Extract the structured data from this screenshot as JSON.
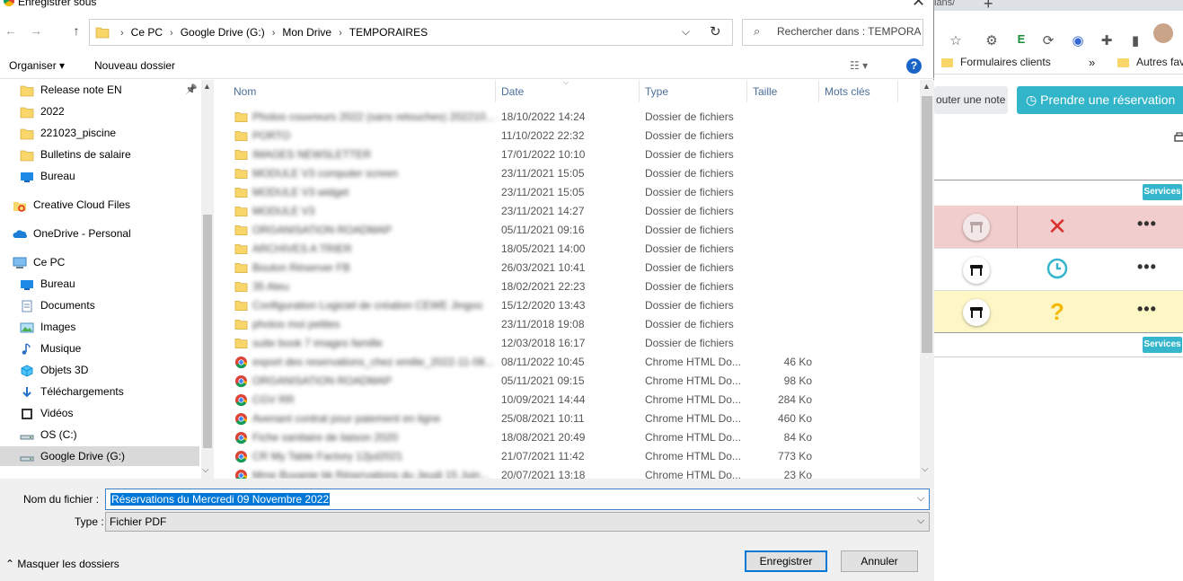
{
  "dialog": {
    "title": "Enregistrer sous",
    "close_glyph": "✕",
    "nav": {
      "back": "←",
      "forward": "→",
      "up": "↑",
      "dropdown": "⌵",
      "refresh": "↻"
    },
    "breadcrumbs": [
      "Ce PC",
      "Google Drive (G:)",
      "Mon Drive",
      "TEMPORAIRES"
    ],
    "search_placeholder": "Rechercher dans : TEMPORA...",
    "toolbar": {
      "organize": "Organiser ▾",
      "new_folder": "Nouveau dossier",
      "view": "☷ ▾",
      "help": "?"
    },
    "nav_pane": [
      {
        "label": "Release note EN",
        "icon": "folder-icon",
        "pinned": true
      },
      {
        "label": "2022",
        "icon": "folder-icon"
      },
      {
        "label": "221023_piscine",
        "icon": "folder-icon"
      },
      {
        "label": "Bulletins de salaire",
        "icon": "folder-icon"
      },
      {
        "label": "Bureau",
        "icon": "desktop-icon"
      },
      {
        "label": "Creative Cloud Files",
        "icon": "creative-cloud-icon"
      },
      {
        "label": "OneDrive - Personal",
        "icon": "onedrive-icon"
      },
      {
        "label": "Ce PC",
        "icon": "computer-icon"
      },
      {
        "label": "Bureau",
        "icon": "desktop-icon"
      },
      {
        "label": "Documents",
        "icon": "documents-icon"
      },
      {
        "label": "Images",
        "icon": "images-icon"
      },
      {
        "label": "Musique",
        "icon": "music-icon"
      },
      {
        "label": "Objets 3D",
        "icon": "objects3d-icon"
      },
      {
        "label": "Téléchargements",
        "icon": "downloads-icon"
      },
      {
        "label": "Vidéos",
        "icon": "videos-icon"
      },
      {
        "label": "OS (C:)",
        "icon": "drive-icon"
      },
      {
        "label": "Google Drive (G:)",
        "icon": "drive-icon",
        "selected": true
      }
    ],
    "columns": [
      "Nom",
      "Date",
      "Type",
      "Taille",
      "Mots clés"
    ],
    "files": [
      {
        "name": "Photos couvreurs 2022 (sans retouches) 202210...",
        "date": "18/10/2022 14:24",
        "type": "Dossier de fichiers",
        "size": "",
        "kind": "folder"
      },
      {
        "name": "PORTO",
        "date": "11/10/2022 22:32",
        "type": "Dossier de fichiers",
        "size": "",
        "kind": "folder"
      },
      {
        "name": "IMAGES NEWSLETTER",
        "date": "17/01/2022 10:10",
        "type": "Dossier de fichiers",
        "size": "",
        "kind": "folder"
      },
      {
        "name": "MODULE V3 computer screen",
        "date": "23/11/2021 15:05",
        "type": "Dossier de fichiers",
        "size": "",
        "kind": "folder"
      },
      {
        "name": "MODULE V3 widget",
        "date": "23/11/2021 15:05",
        "type": "Dossier de fichiers",
        "size": "",
        "kind": "folder"
      },
      {
        "name": "MODULE V3",
        "date": "23/11/2021 14:27",
        "type": "Dossier de fichiers",
        "size": "",
        "kind": "folder"
      },
      {
        "name": "ORGANISATION ROADMAP",
        "date": "05/11/2021 09:16",
        "type": "Dossier de fichiers",
        "size": "",
        "kind": "folder"
      },
      {
        "name": "ARCHIVES A TRIER",
        "date": "18/05/2021 14:00",
        "type": "Dossier de fichiers",
        "size": "",
        "kind": "folder"
      },
      {
        "name": "Bouton Réserver FB",
        "date": "26/03/2021 10:41",
        "type": "Dossier de fichiers",
        "size": "",
        "kind": "folder"
      },
      {
        "name": "35 Ateu",
        "date": "18/02/2021 22:23",
        "type": "Dossier de fichiers",
        "size": "",
        "kind": "folder"
      },
      {
        "name": "Configuration Logiciel de création CEWE Jingoo",
        "date": "15/12/2020 13:43",
        "type": "Dossier de fichiers",
        "size": "",
        "kind": "folder"
      },
      {
        "name": "photos moi petites",
        "date": "23/11/2018 19:08",
        "type": "Dossier de fichiers",
        "size": "",
        "kind": "folder"
      },
      {
        "name": "suite book 7 images famille",
        "date": "12/03/2018 16:17",
        "type": "Dossier de fichiers",
        "size": "",
        "kind": "folder"
      },
      {
        "name": "export des reservations_chez emilie_2022-11-08...",
        "date": "08/11/2022 10:45",
        "type": "Chrome HTML Do...",
        "size": "46 Ko",
        "kind": "chrome"
      },
      {
        "name": "ORGANISATION ROADMAP",
        "date": "05/11/2021 09:15",
        "type": "Chrome HTML Do...",
        "size": "98 Ko",
        "kind": "chrome"
      },
      {
        "name": "CGV RR",
        "date": "10/09/2021 14:44",
        "type": "Chrome HTML Do...",
        "size": "284 Ko",
        "kind": "chrome"
      },
      {
        "name": "Avenant contrat pour paiement en ligne",
        "date": "25/08/2021 10:11",
        "type": "Chrome HTML Do...",
        "size": "460 Ko",
        "kind": "chrome"
      },
      {
        "name": "Fiche sanitaire de liaison 2020",
        "date": "18/08/2021 20:49",
        "type": "Chrome HTML Do...",
        "size": "84 Ko",
        "kind": "chrome"
      },
      {
        "name": "CR My Table Factory 12jul2021",
        "date": "21/07/2021 11:42",
        "type": "Chrome HTML Do...",
        "size": "773 Ko",
        "kind": "chrome"
      },
      {
        "name": "Mme Buvanie bk Réservations du Jeudi 15 Juin...",
        "date": "20/07/2021 13:18",
        "type": "Chrome HTML Do...",
        "size": "23 Ko",
        "kind": "chrome"
      }
    ],
    "filename_label": "Nom du fichier :",
    "filename_value": "Réservations du Mercredi 09 Novembre 2022",
    "type_label": "Type :",
    "type_value": "Fichier PDF",
    "hide_folders": "Masquer les dossiers",
    "save": "Enregistrer",
    "cancel": "Annuler"
  },
  "background": {
    "tab_text": "lans/",
    "tab_plus": "+",
    "bookmarks": [
      "Formulaires clients",
      "»",
      "Autres fav"
    ],
    "add_note": "outer une note",
    "reservation_button": "Prendre une réservation",
    "services_badge": "Services",
    "row_status": [
      "✕",
      "clock",
      "?"
    ],
    "row_menu": "•••",
    "colors": {
      "accent": "#33b5c9",
      "row_red": "#f2cdcd",
      "row_yellow": "#fdf7c6",
      "cancel_x": "#d9302c",
      "pending": "#f5b700"
    }
  }
}
